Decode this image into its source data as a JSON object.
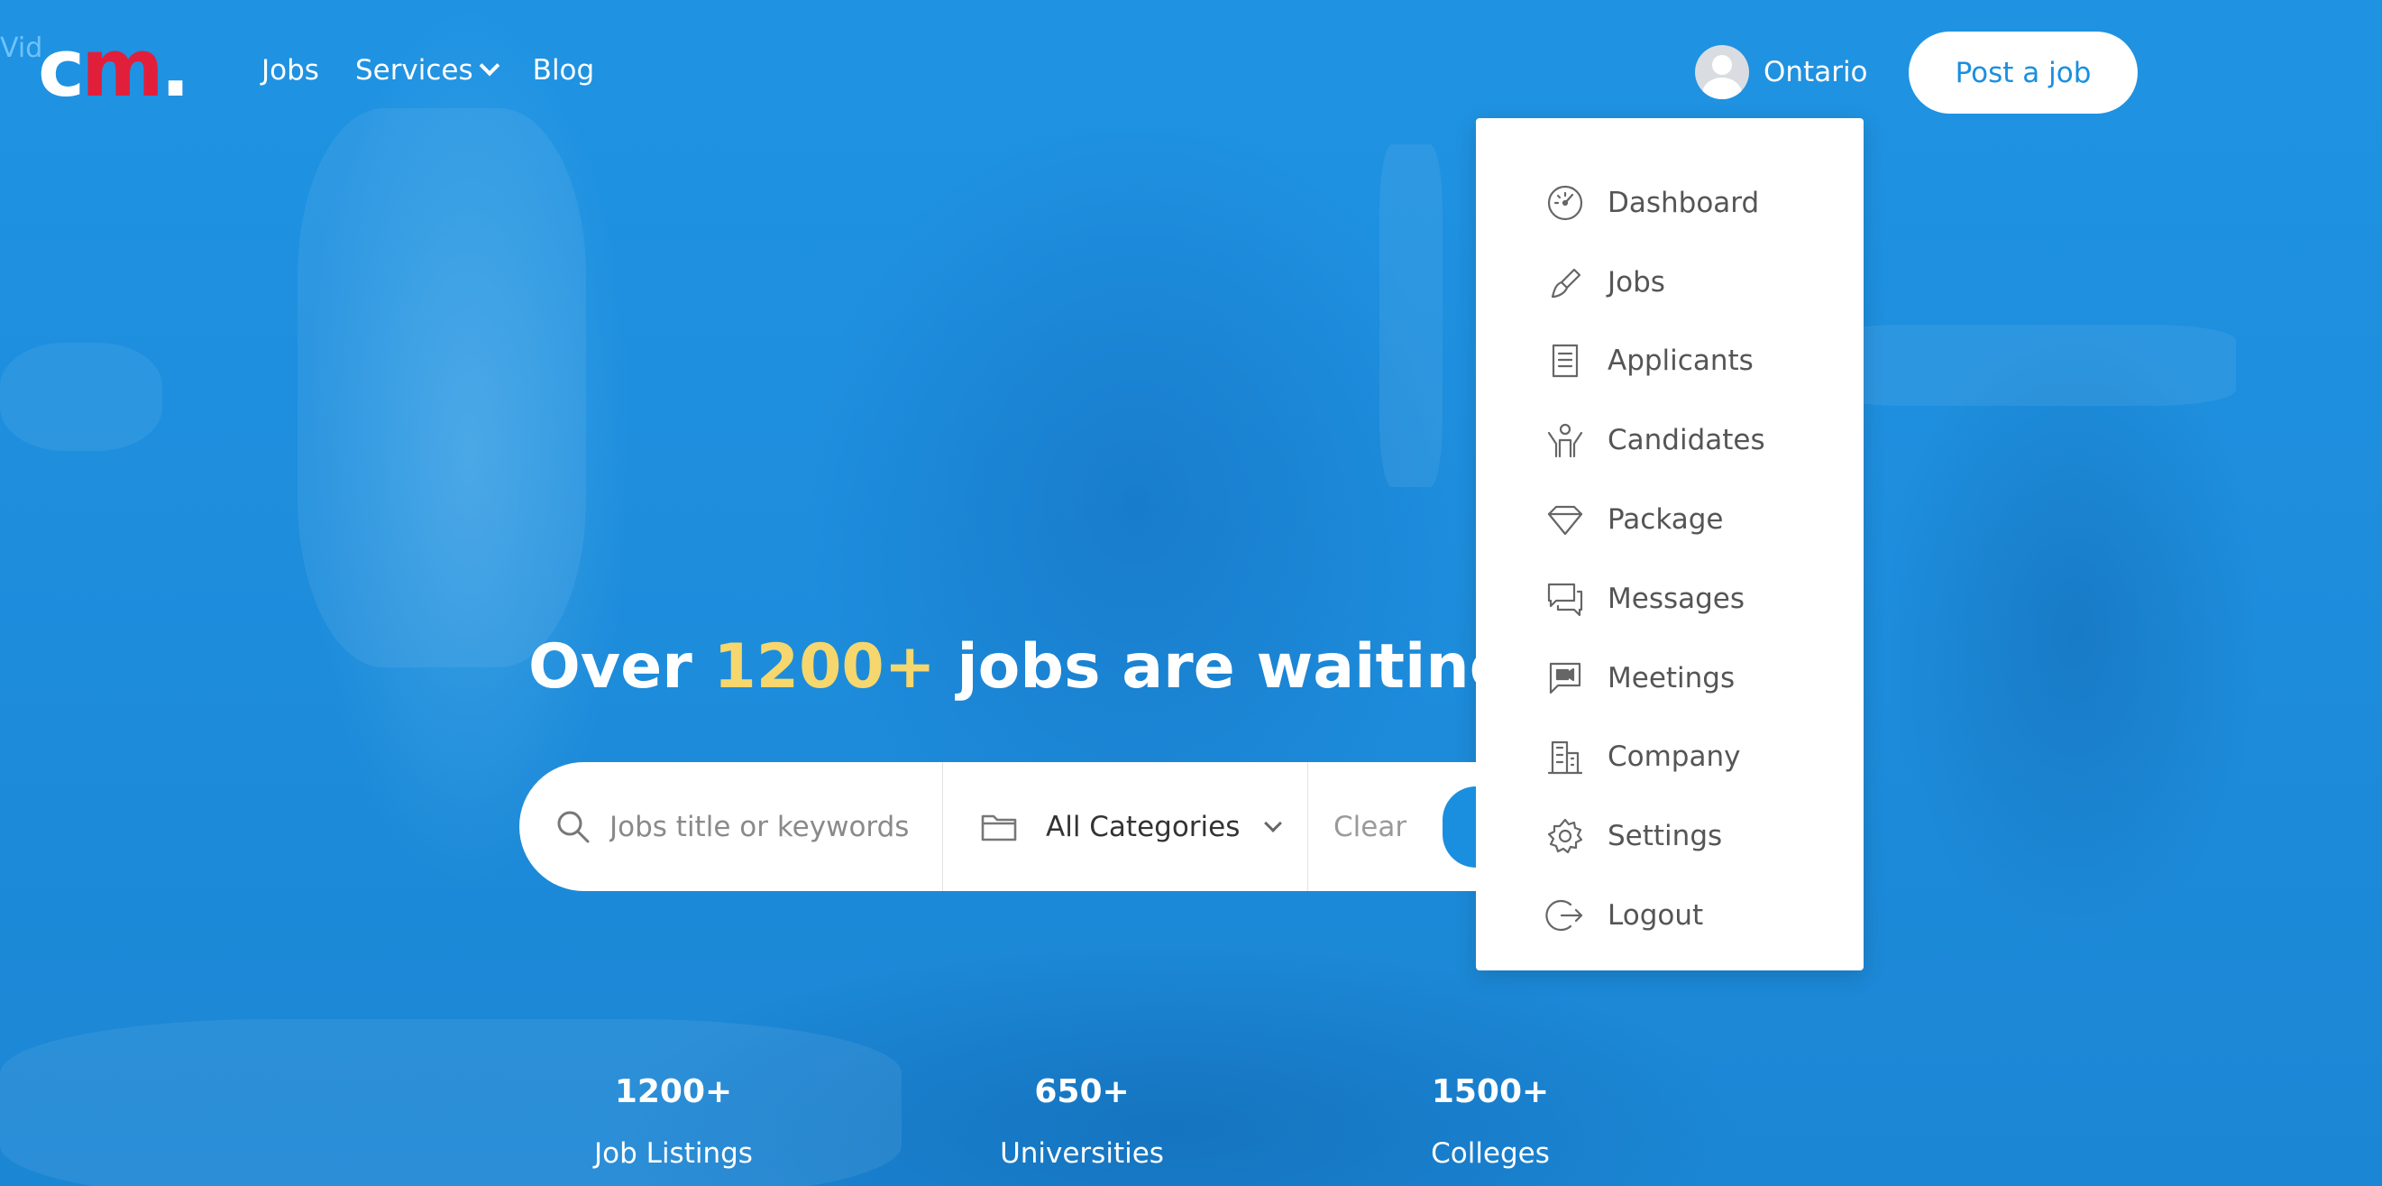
{
  "header": {
    "video_label": "Vid",
    "logo": {
      "c": "c",
      "m": "m",
      "dot": "."
    },
    "nav": {
      "jobs": "Jobs",
      "services": "Services",
      "blog": "Blog"
    },
    "user_name": "Ontario",
    "post_job": "Post a job"
  },
  "menu": {
    "items": [
      {
        "label": "Dashboard",
        "icon": "dashboard-gauge-icon"
      },
      {
        "label": "Jobs",
        "icon": "brush-icon"
      },
      {
        "label": "Applicants",
        "icon": "document-list-icon"
      },
      {
        "label": "Candidates",
        "icon": "person-raised-arms-icon"
      },
      {
        "label": "Package",
        "icon": "diamond-icon"
      },
      {
        "label": "Messages",
        "icon": "chat-bubbles-icon"
      },
      {
        "label": "Meetings",
        "icon": "video-chat-icon"
      },
      {
        "label": "Company",
        "icon": "building-icon"
      },
      {
        "label": "Settings",
        "icon": "gear-icon"
      },
      {
        "label": "Logout",
        "icon": "logout-icon"
      }
    ]
  },
  "hero": {
    "title_pre": "Over ",
    "title_highlight": "1200+",
    "title_post": " jobs are waiting fo"
  },
  "search": {
    "keyword_placeholder": "Jobs title or keywords",
    "category": "All Categories",
    "clear": "Clear"
  },
  "stats": [
    {
      "value": "1200+",
      "label": "Job Listings"
    },
    {
      "value": "650+",
      "label": "Universities"
    },
    {
      "value": "1500+",
      "label": "Colleges"
    }
  ],
  "colors": {
    "primary": "#1a8fe0",
    "highlight": "#f5d76e",
    "logo_red": "#e21f3b"
  }
}
